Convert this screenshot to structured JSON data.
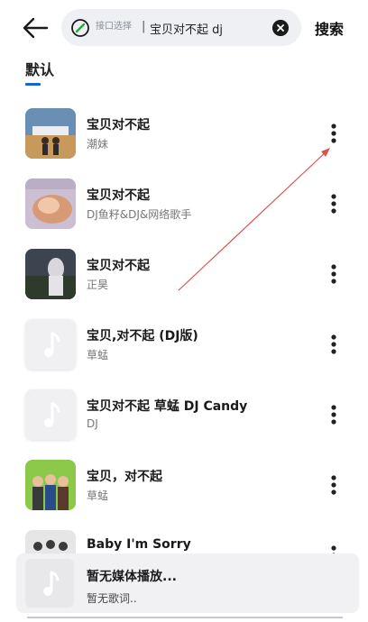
{
  "search": {
    "interface_label": "接口选择",
    "separator": "|",
    "query": "宝贝对不起 dj",
    "submit_label": "搜索"
  },
  "tabs": {
    "default_label": "默认"
  },
  "songs": [
    {
      "title": "宝贝对不起",
      "artist": "潮妹",
      "cover": "album-art-couple"
    },
    {
      "title": "宝贝对不起",
      "artist": "DJ鱼籽&DJ&网络歌手",
      "cover": "album-art-blur"
    },
    {
      "title": "宝贝对不起",
      "artist": "正昊",
      "cover": "album-art-dark-photo"
    },
    {
      "title": "宝贝,对不起 (DJ版)",
      "artist": "草蜢",
      "cover": "music-note-placeholder"
    },
    {
      "title": "宝贝对不起 草蜢 DJ Candy",
      "artist": "DJ",
      "cover": "music-note-placeholder"
    },
    {
      "title": "宝贝，对不起",
      "artist": "草蜢",
      "cover": "album-art-group"
    },
    {
      "title": "Baby I'm Sorry",
      "artist": "",
      "cover": "album-art-group"
    }
  ],
  "player": {
    "title": "暂无媒体播放...",
    "lyric": "暂无歌词.."
  },
  "colors": {
    "accent": "#1a63d6",
    "search_bg": "#eef0f3",
    "annotation": "#d9534f"
  }
}
